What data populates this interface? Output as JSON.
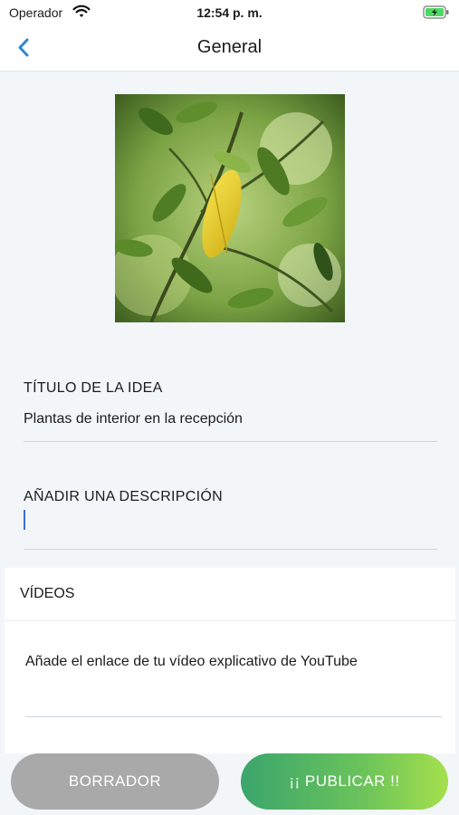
{
  "status_bar": {
    "carrier": "Operador",
    "time": "12:54 p. m."
  },
  "nav": {
    "title": "General"
  },
  "form": {
    "title_label": "TÍTULO DE LA IDEA",
    "title_value": "Plantas de interior en la recepción",
    "description_label": "AÑADIR UNA DESCRIPCIÓN",
    "description_value": ""
  },
  "videos": {
    "section_title": "VÍDEOS",
    "link_placeholder": "Añade el enlace de tu vídeo explicativo de YouTube"
  },
  "actions": {
    "draft_label": "BORRADOR",
    "publish_label": "¡¡ PUBLICAR !!"
  },
  "colors": {
    "accent": "#2f86d8",
    "publish_start": "#3aa56c",
    "publish_end": "#a5e04d",
    "draft": "#a9a9a9",
    "battery": "#4cd964"
  }
}
